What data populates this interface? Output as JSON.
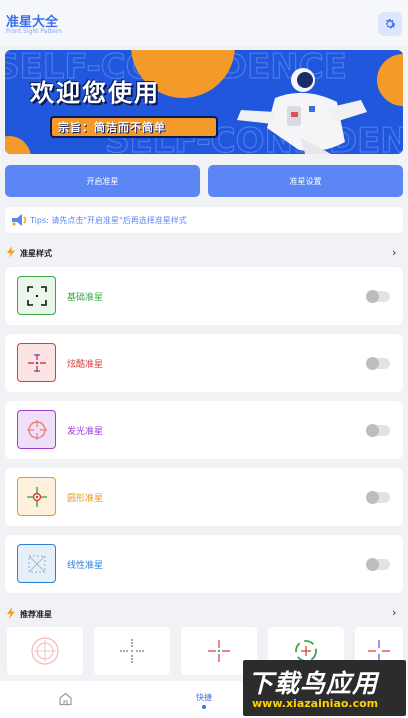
{
  "header": {
    "title": "准星大全",
    "subtitle": "Front Sight Pattern",
    "settings_icon": "gear-icon"
  },
  "banner": {
    "main_text": "欢迎您使用",
    "tagline": "宗旨：简洁而不简单",
    "bg_text": "SELF-CONFIDENCE"
  },
  "actions": {
    "start_label": "开启准星",
    "settings_label": "准星设置"
  },
  "tips": {
    "text": "Tips: 请先点击\"开启准星\"后再选择准星样式"
  },
  "styles_section": {
    "title": "准星样式",
    "items": [
      {
        "label": "基础准星",
        "color": "#3aa84a",
        "bg": "#eaf6ea",
        "icon": "bracket-crosshair-icon",
        "enabled": false
      },
      {
        "label": "炫酷准星",
        "color": "#e03a3a",
        "bg": "#fde4e4",
        "icon": "cool-crosshair-icon",
        "enabled": false
      },
      {
        "label": "发光准星",
        "color": "#9b3fcf",
        "bg": "#f0dff8",
        "icon": "glow-crosshair-icon",
        "enabled": false
      },
      {
        "label": "圆形准星",
        "color": "#e89a1a",
        "bg": "#fdf0dc",
        "icon": "circle-crosshair-icon",
        "enabled": false
      },
      {
        "label": "线性准星",
        "color": "#2c7fd6",
        "bg": "#e6f0fb",
        "icon": "line-crosshair-icon",
        "enabled": false
      }
    ]
  },
  "recommend_section": {
    "title": "推荐准星"
  },
  "tabbar": {
    "home_icon": "home-icon",
    "active_label": "快捷"
  },
  "watermark": {
    "main": "下载鸟应用",
    "url": "www.xiazainiao.com"
  }
}
